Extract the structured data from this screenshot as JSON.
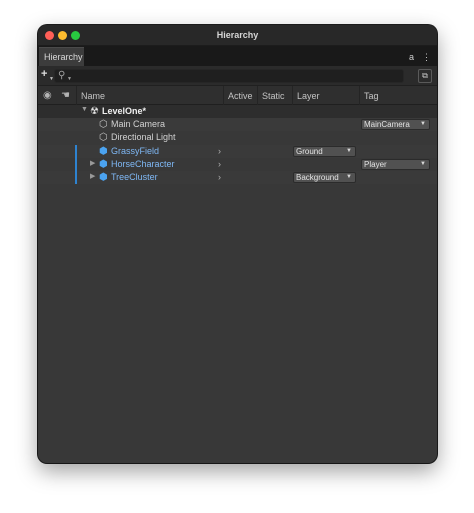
{
  "window": {
    "title": "Hierarchy"
  },
  "tab": {
    "label": "Hierarchy",
    "lock_glyph": "a",
    "menu_glyph": "⋮"
  },
  "toolbar": {
    "add_glyph": "+",
    "search_placeholder": "",
    "search_value": ""
  },
  "columns": {
    "name": "Name",
    "active": "Active",
    "static": "Static",
    "layer": "Layer",
    "tag": "Tag"
  },
  "scene": {
    "name": "LevelOne*"
  },
  "objects": [
    {
      "name": "Main Camera",
      "tag": "MainCamera"
    },
    {
      "name": "Directional Light"
    },
    {
      "name": "GrassyField",
      "layer": "Ground"
    },
    {
      "name": "HorseCharacter",
      "tag": "Player"
    },
    {
      "name": "TreeCluster",
      "layer": "Background"
    }
  ],
  "colors": {
    "prefab_blue": "#7fb8f5",
    "selection_indicator": "#2e83d0",
    "window_bg": "#383838"
  },
  "icons": {
    "eye": "visibility-eye-icon",
    "hand": "pickability-hand-icon",
    "scene": "unity-scene-icon",
    "gameobject": "cube-outline-icon",
    "prefab": "prefab-cube-icon"
  }
}
